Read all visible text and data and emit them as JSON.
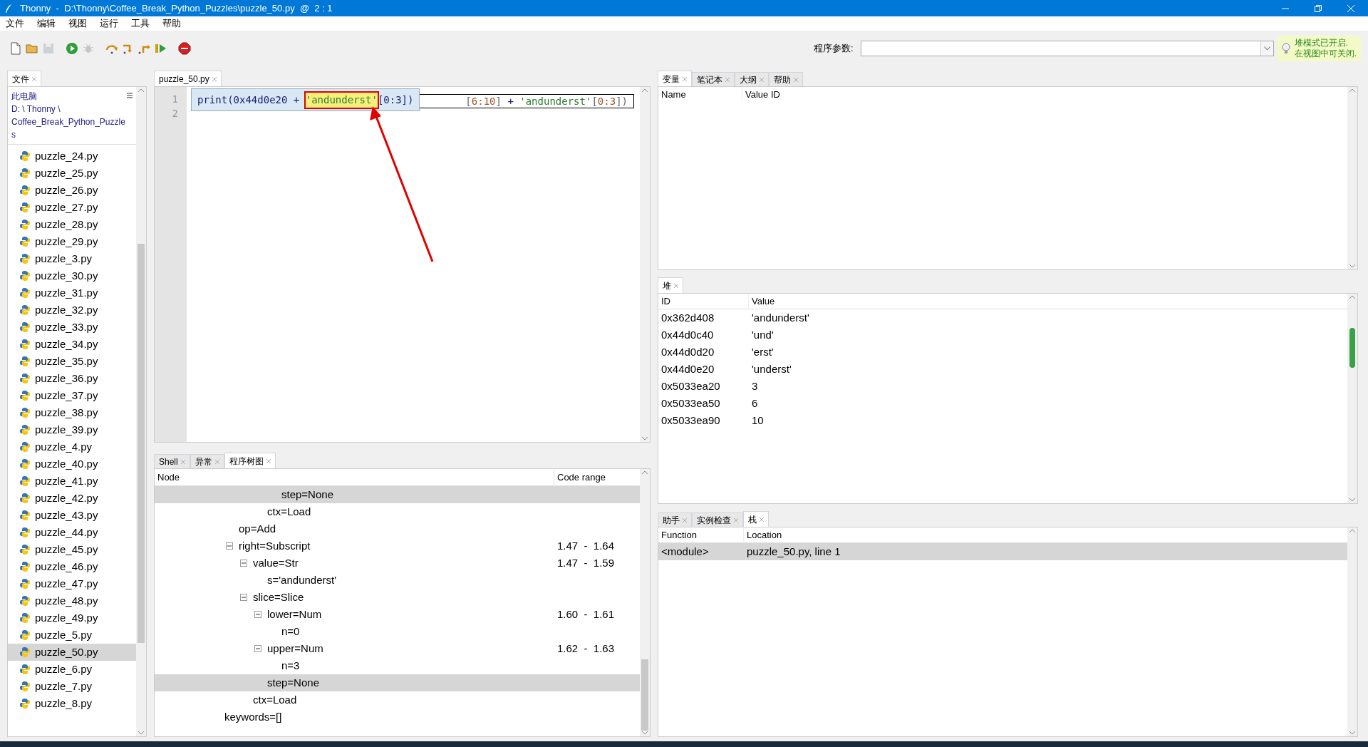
{
  "window": {
    "title": "Thonny  -  D:\\Thonny\\Coffee_Break_Python_Puzzles\\puzzle_50.py  @  2 : 1"
  },
  "menu": [
    "文件",
    "编辑",
    "视图",
    "运行",
    "工具",
    "帮助"
  ],
  "toolbar": [
    {
      "kind": "new",
      "disabled": false
    },
    {
      "kind": "open",
      "disabled": false
    },
    {
      "kind": "save",
      "disabled": true
    },
    {
      "kind": "run",
      "disabled": false
    },
    {
      "kind": "debug",
      "disabled": true
    },
    {
      "kind": "step-over",
      "disabled": false
    },
    {
      "kind": "step-into",
      "disabled": false
    },
    {
      "kind": "step-out",
      "disabled": false
    },
    {
      "kind": "resume",
      "disabled": false
    },
    {
      "kind": "stop",
      "disabled": false
    }
  ],
  "program_args": {
    "label": "程序参数:"
  },
  "heap_notice": [
    "堆模式已开启.",
    "在视图中可关闭."
  ],
  "files": {
    "tabs": [
      {
        "label": "文件",
        "selected": true
      }
    ],
    "location": [
      "此电脑",
      "D: \\ Thonny \\",
      "Coffee_Break_Python_Puzzle",
      "s"
    ],
    "items": [
      {
        "name": "puzzle_24.py",
        "selected": false
      },
      {
        "name": "puzzle_25.py",
        "selected": false
      },
      {
        "name": "puzzle_26.py",
        "selected": false
      },
      {
        "name": "puzzle_27.py",
        "selected": false
      },
      {
        "name": "puzzle_28.py",
        "selected": false
      },
      {
        "name": "puzzle_29.py",
        "selected": false
      },
      {
        "name": "puzzle_3.py",
        "selected": false
      },
      {
        "name": "puzzle_30.py",
        "selected": false
      },
      {
        "name": "puzzle_31.py",
        "selected": false
      },
      {
        "name": "puzzle_32.py",
        "selected": false
      },
      {
        "name": "puzzle_33.py",
        "selected": false
      },
      {
        "name": "puzzle_34.py",
        "selected": false
      },
      {
        "name": "puzzle_35.py",
        "selected": false
      },
      {
        "name": "puzzle_36.py",
        "selected": false
      },
      {
        "name": "puzzle_37.py",
        "selected": false
      },
      {
        "name": "puzzle_38.py",
        "selected": false
      },
      {
        "name": "puzzle_39.py",
        "selected": false
      },
      {
        "name": "puzzle_4.py",
        "selected": false
      },
      {
        "name": "puzzle_40.py",
        "selected": false
      },
      {
        "name": "puzzle_41.py",
        "selected": false
      },
      {
        "name": "puzzle_42.py",
        "selected": false
      },
      {
        "name": "puzzle_43.py",
        "selected": false
      },
      {
        "name": "puzzle_44.py",
        "selected": false
      },
      {
        "name": "puzzle_45.py",
        "selected": false
      },
      {
        "name": "puzzle_46.py",
        "selected": false
      },
      {
        "name": "puzzle_47.py",
        "selected": false
      },
      {
        "name": "puzzle_48.py",
        "selected": false
      },
      {
        "name": "puzzle_49.py",
        "selected": false
      },
      {
        "name": "puzzle_5.py",
        "selected": false
      },
      {
        "name": "puzzle_50.py",
        "selected": true
      },
      {
        "name": "puzzle_6.py",
        "selected": false
      },
      {
        "name": "puzzle_7.py",
        "selected": false
      },
      {
        "name": "puzzle_8.py",
        "selected": false
      }
    ]
  },
  "editor": {
    "tabs": [
      {
        "label": "puzzle_50.py",
        "selected": true
      }
    ],
    "line_numbers": [
      "1",
      "2"
    ],
    "line_tail": [
      {
        "kind": "punct",
        "text": "["
      },
      {
        "kind": "number",
        "text": "6:10"
      },
      {
        "kind": "punct",
        "text": "]"
      },
      {
        "kind": "plain",
        "text": " + "
      },
      {
        "kind": "string",
        "text": "'andunderst'"
      },
      {
        "kind": "punct",
        "text": "["
      },
      {
        "kind": "number",
        "text": "0:3"
      },
      {
        "kind": "punct",
        "text": "])"
      }
    ],
    "popup": [
      {
        "kind": "plain",
        "text": "print(0x44d0e20 + "
      },
      {
        "kind": "focus",
        "text": "'andunderst'"
      },
      {
        "kind": "plain",
        "text": "[0:3])"
      }
    ]
  },
  "tree": {
    "tabs": [
      {
        "label": "Shell",
        "selected": false
      },
      {
        "label": "异常",
        "selected": false
      },
      {
        "label": "程序树图",
        "selected": true
      }
    ],
    "columns": [
      "Node",
      "Code range"
    ],
    "nodes": [
      {
        "children": [
          {
            "children": [
              {
                "children": [
                  {
                    "children": [
                      {
                        "label": "step=None",
                        "selected": true
                      }
                    ]
                  },
                  {
                    "label": "ctx=Load",
                    "selected": false
                  }
                ]
              }
            ]
          },
          {
            "label": "op=Add",
            "selected": false
          },
          {
            "label": "right=Subscript",
            "range": "1.47  -  1.64",
            "expanded": true,
            "selected": false,
            "children": [
              {
                "label": "value=Str",
                "range": "1.47  -  1.59",
                "expanded": true,
                "selected": false,
                "children": [
                  {
                    "label": "s='andunderst'",
                    "selected": false
                  }
                ]
              },
              {
                "label": "slice=Slice",
                "expanded": true,
                "selected": false,
                "children": [
                  {
                    "label": "lower=Num",
                    "range": "1.60  -  1.61",
                    "expanded": true,
                    "selected": false,
                    "children": [
                      {
                        "label": "n=0",
                        "selected": false
                      }
                    ]
                  },
                  {
                    "label": "upper=Num",
                    "range": "1.62  -  1.63",
                    "expanded": true,
                    "selected": false,
                    "children": [
                      {
                        "label": "n=3",
                        "selected": false
                      }
                    ]
                  },
                  {
                    "label": "step=None",
                    "selected": true
                  }
                ]
              },
              {
                "label": "ctx=Load",
                "selected": false
              }
            ]
          }
        ]
      },
      {
        "label": "keywords=[]",
        "selected": false
      }
    ]
  },
  "variables": {
    "tabs": [
      {
        "label": "变量",
        "selected": true
      },
      {
        "label": "笔记本",
        "selected": false
      },
      {
        "label": "大纲",
        "selected": false
      },
      {
        "label": "帮助",
        "selected": false
      }
    ],
    "columns": [
      "Name",
      "Value ID"
    ]
  },
  "heap": {
    "tabs": [
      {
        "label": "堆",
        "selected": true
      }
    ],
    "columns": [
      "ID",
      "Value"
    ],
    "rows": [
      [
        "0x362d408",
        "'andunderst'"
      ],
      [
        "0x44d0c40",
        "'und'"
      ],
      [
        "0x44d0d20",
        "'erst'"
      ],
      [
        "0x44d0e20",
        "'underst'"
      ],
      [
        "0x5033ea20",
        "3"
      ],
      [
        "0x5033ea50",
        "6"
      ],
      [
        "0x5033ea90",
        "10"
      ]
    ]
  },
  "stack": {
    "tabs": [
      {
        "label": "助手",
        "selected": false
      },
      {
        "label": "实例检查",
        "selected": false
      },
      {
        "label": "栈",
        "selected": true
      }
    ],
    "columns": [
      "Function",
      "Location"
    ],
    "rows": [
      {
        "function": "<module>",
        "location": "puzzle_50.py, line 1",
        "selected": true
      }
    ]
  }
}
